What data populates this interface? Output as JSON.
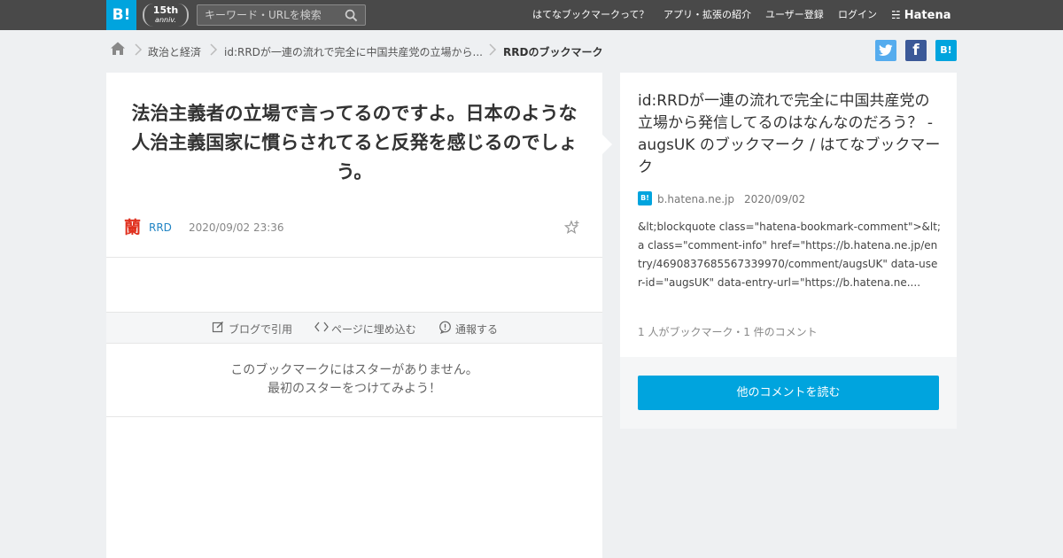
{
  "header": {
    "logo": "B!",
    "anniv_big": "15th",
    "anniv_small": "anniv.",
    "search_placeholder": "キーワード・URLを検索",
    "nav": [
      {
        "label": "はてなブックマークって？"
      },
      {
        "label": "アプリ・拡張の紹介"
      },
      {
        "label": "ユーザー登録"
      },
      {
        "label": "ログイン"
      }
    ],
    "brand": "Hatena"
  },
  "breadcrumb": {
    "items": [
      {
        "label": "政治と経済"
      },
      {
        "label": "id:RRDが一連の流れで完全に中国共産党の立場から..."
      },
      {
        "label": "RRDのブックマーク"
      }
    ]
  },
  "share": {
    "twitter": "t",
    "facebook": "f",
    "hatena": "B!"
  },
  "comment": {
    "text": "法治主義者の立場で言ってるのですよ。日本のような人治主義国家に慣らされてると反発を感じるのでしょう。",
    "avatar_char": "蘭",
    "user": "RRD",
    "timestamp": "2020/09/02 23:36"
  },
  "tools": {
    "cite": "ブログで引用",
    "embed": "ページに埋め込む",
    "report": "通報する"
  },
  "stars": {
    "line1": "このブックマークにはスターがありません。",
    "line2": "最初のスターをつけてみよう！"
  },
  "entry": {
    "title": "id:RRDが一連の流れで完全に中国共産党の立場から発信してるのはなんなのだろう？ - augsUK のブックマーク / はてなブックマーク",
    "favicon": "B!",
    "domain": "b.hatena.ne.jp",
    "date": "2020/09/02",
    "summary": "&lt;blockquote class=\"hatena-bookmark-comment\">&lt;a class=\"comment-info\" href=\"https://b.hatena.ne.jp/entry/4690837685567339970/comment/augsUK\" data-user-id=\"augsUK\" data-entry-url=\"https://b.hatena.ne....",
    "counts": "1 人がブックマーク・1 件のコメント",
    "read_more": "他のコメントを読む"
  },
  "colors": {
    "accent": "#00a4de",
    "topbar": "#494949",
    "twitter": "#55acee",
    "facebook": "#3b5998"
  }
}
